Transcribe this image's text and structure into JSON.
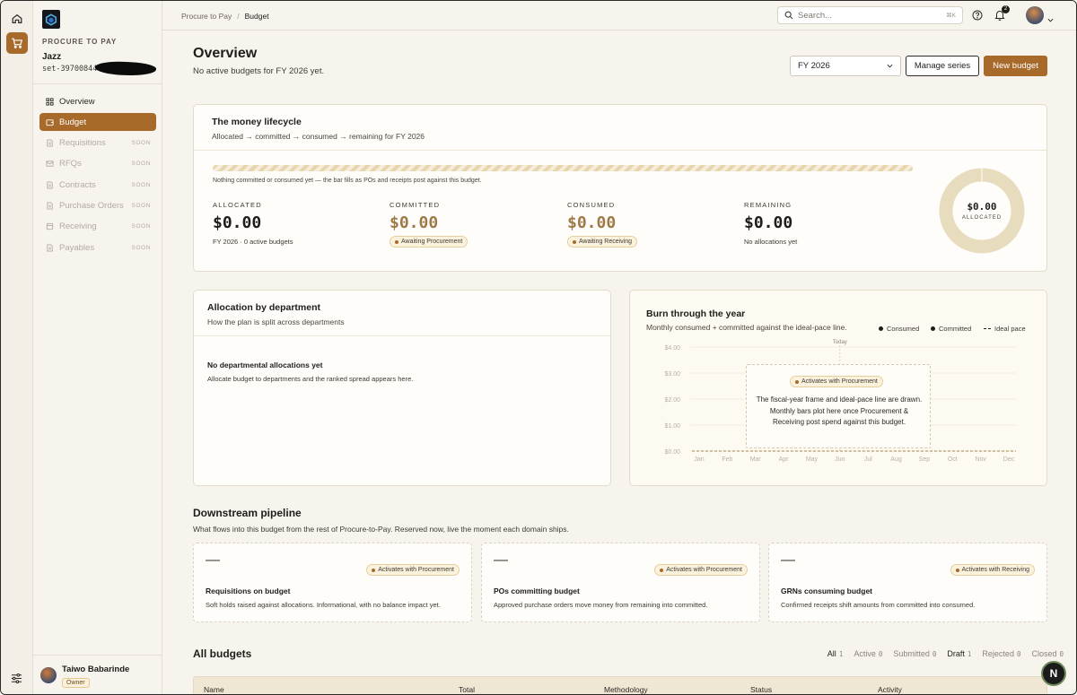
{
  "colors": {
    "accent": "#a86a2a",
    "ink": "#1f1d1a",
    "muted": "#b2aca1",
    "donut": "#e8dcbe"
  },
  "sidebar": {
    "section_label": "PROCURE TO PAY",
    "org_name": "Jazz",
    "org_id": "set-39700844",
    "items": [
      {
        "label": "Overview",
        "icon": "grid-icon",
        "soon": ""
      },
      {
        "label": "Budget",
        "icon": "wallet-icon",
        "soon": ""
      },
      {
        "label": "Requisitions",
        "icon": "document-icon",
        "soon": "SOON"
      },
      {
        "label": "RFQs",
        "icon": "mail-icon",
        "soon": "SOON"
      },
      {
        "label": "Contracts",
        "icon": "document-icon",
        "soon": "SOON"
      },
      {
        "label": "Purchase Orders",
        "icon": "document-icon",
        "soon": "SOON"
      },
      {
        "label": "Receiving",
        "icon": "box-icon",
        "soon": "SOON"
      },
      {
        "label": "Payables",
        "icon": "document-icon",
        "soon": "SOON"
      }
    ],
    "user": {
      "name": "Taiwo Babarinde",
      "role": "Owner"
    }
  },
  "topbar": {
    "breadcrumb": [
      "Procure to Pay",
      "Budget"
    ],
    "search_placeholder": "Search...",
    "search_shortcut": "⌘K",
    "notification_count": "2"
  },
  "header": {
    "title": "Overview",
    "subtitle": "No active budgets for FY 2026 yet.",
    "fiscal_year": "FY 2026",
    "manage_label": "Manage series",
    "new_label": "New budget"
  },
  "lifecycle": {
    "title": "The money lifecycle",
    "subtitle": "Allocated → committed → consumed → remaining for FY 2026",
    "bar_note": "Nothing committed or consumed yet — the bar fills as POs and receipts post against this budget.",
    "bar_fill": 0,
    "stats": [
      {
        "label": "ALLOCATED",
        "value": "$0.00",
        "note": "FY 2026 · 0 active budgets",
        "pill": ""
      },
      {
        "label": "COMMITTED",
        "value": "$0.00",
        "note": "",
        "pill": "Awaiting Procurement"
      },
      {
        "label": "CONSUMED",
        "value": "$0.00",
        "note": "",
        "pill": "Awaiting Receiving"
      },
      {
        "label": "REMAINING",
        "value": "$0.00",
        "note": "No allocations yet",
        "pill": ""
      }
    ],
    "donut_value": "$0.00",
    "donut_label": "ALLOCATED"
  },
  "allocation": {
    "title": "Allocation by department",
    "subtitle": "How the plan is split across departments",
    "empty_title": "No departmental allocations yet",
    "empty_sub": "Allocate budget to departments and the ranked spread appears here."
  },
  "burn": {
    "title": "Burn through the year",
    "subtitle": "Monthly consumed + committed against the ideal-pace line.",
    "legend": [
      "Consumed",
      "Committed",
      "Ideal pace"
    ],
    "today_label": "Today",
    "overlay_pill": "Activates with Procurement",
    "overlay_text": "The fiscal-year frame and ideal-pace line are drawn. Monthly bars plot here once Procurement & Receiving post spend against this budget."
  },
  "chart_data": {
    "type": "bar",
    "title": "Burn through the year",
    "categories": [
      "Jan",
      "Feb",
      "Mar",
      "Apr",
      "May",
      "Jun",
      "Jul",
      "Aug",
      "Sep",
      "Oct",
      "Nov",
      "Dec"
    ],
    "yticks": [
      "$4.00",
      "$3.00",
      "$2.00",
      "$1.00",
      "$0.00"
    ],
    "ylim": [
      0,
      4
    ],
    "series": [
      {
        "name": "Consumed",
        "values": [
          0,
          0,
          0,
          0,
          0,
          0,
          0,
          0,
          0,
          0,
          0,
          0
        ]
      },
      {
        "name": "Committed",
        "values": [
          0,
          0,
          0,
          0,
          0,
          0,
          0,
          0,
          0,
          0,
          0,
          0
        ]
      },
      {
        "name": "Ideal pace",
        "values": [
          0,
          0,
          0,
          0,
          0,
          0,
          0,
          0,
          0,
          0,
          0,
          0
        ]
      }
    ],
    "today_month": "Jun",
    "legend_position": "top-right"
  },
  "downstream": {
    "title": "Downstream pipeline",
    "subtitle": "What flows into this budget from the rest of Procure-to-Pay. Reserved now, live the moment each domain ships.",
    "cards": [
      {
        "value": "—",
        "pill": "Activates with Procurement",
        "title": "Requisitions on budget",
        "desc": "Soft holds raised against allocations. Informational, with no balance impact yet."
      },
      {
        "value": "—",
        "pill": "Activates with Procurement",
        "title": "POs committing budget",
        "desc": "Approved purchase orders move money from remaining into committed."
      },
      {
        "value": "—",
        "pill": "Activates with Receiving",
        "title": "GRNs consuming budget",
        "desc": "Confirmed receipts shift amounts from committed into consumed."
      }
    ]
  },
  "budgets": {
    "title": "All budgets",
    "filters": [
      {
        "label": "All",
        "count": "1"
      },
      {
        "label": "Active",
        "count": "0"
      },
      {
        "label": "Submitted",
        "count": "0"
      },
      {
        "label": "Draft",
        "count": "1"
      },
      {
        "label": "Rejected",
        "count": "0"
      },
      {
        "label": "Closed",
        "count": "0"
      }
    ],
    "columns": [
      "Name",
      "Total",
      "Methodology",
      "Status",
      "Activity"
    ]
  },
  "assistant_label": "N"
}
